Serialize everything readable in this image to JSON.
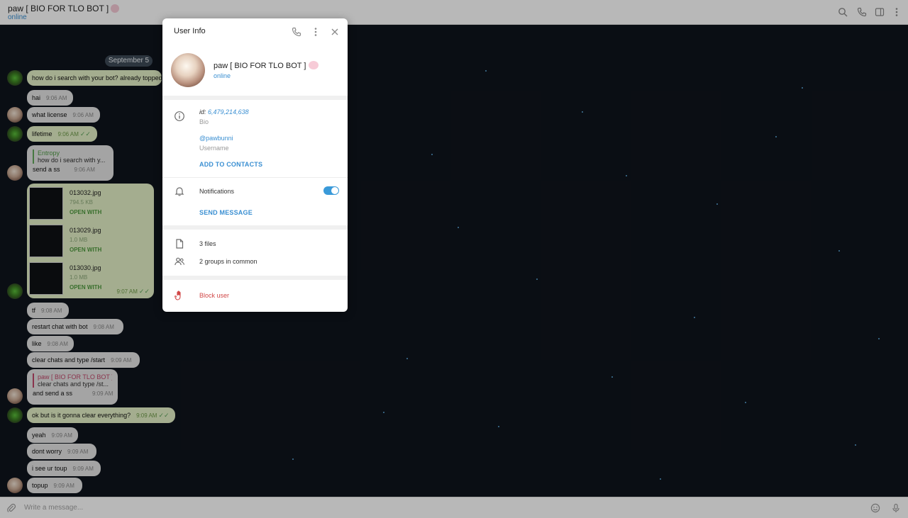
{
  "header": {
    "chat_title": "paw [ BIO FOR TLO BOT ]",
    "chat_status": "online",
    "icons": [
      "search-icon",
      "phone-icon",
      "sidebar-icon",
      "more-icon"
    ]
  },
  "chat": {
    "date_separator": "September 5",
    "messages": [
      {
        "text": "how do i search with your bot? already topped",
        "time": ""
      },
      {
        "text": "hai",
        "time": "9:06 AM"
      },
      {
        "text": "what license",
        "time": "9:06 AM"
      },
      {
        "text": "lifetime",
        "time": "9:06 AM"
      },
      {
        "reply_author": "Entropy",
        "reply_text": "how do i search with y...",
        "text": "send a ss",
        "time": "9:06 AM"
      },
      {
        "text": "tf",
        "time": "9:08 AM"
      },
      {
        "text": "restart chat with bot",
        "time": "9:08 AM"
      },
      {
        "text": "like",
        "time": "9:08 AM"
      },
      {
        "text": "clear chats and type /start",
        "time": "9:09 AM"
      },
      {
        "reply_author": "paw [ BIO FOR TLO BOT ]",
        "reply_text": "clear chats and type /st...",
        "text": "and send a ss",
        "time": "9:09 AM"
      },
      {
        "text": "ok but is it gonna clear everything?",
        "time": "9:09 AM"
      },
      {
        "text": "yeah",
        "time": "9:09 AM"
      },
      {
        "text": "dont worry",
        "time": "9:09 AM"
      },
      {
        "text": "i see ur toup",
        "time": "9:09 AM"
      },
      {
        "text": "topup",
        "time": "9:09 AM"
      }
    ],
    "files": [
      {
        "name": "013032.jpg",
        "size": "794.5 KB",
        "action": "OPEN WITH"
      },
      {
        "name": "013029.jpg",
        "size": "1.0 MB",
        "action": "OPEN WITH"
      },
      {
        "name": "013030.jpg",
        "size": "1.0 MB",
        "action": "OPEN WITH"
      }
    ],
    "files_time": "9:07 AM"
  },
  "composer": {
    "placeholder": "Write a message..."
  },
  "modal": {
    "title": "User Info",
    "name": "paw [ BIO FOR TLO BOT ]",
    "status": "online",
    "id_label": "id:",
    "id_value": "6,479,214,638",
    "bio_label": "Bio",
    "username": "@pawbunni",
    "username_label": "Username",
    "add_contacts": "ADD TO CONTACTS",
    "notifications": "Notifications",
    "notifications_on": true,
    "send_message": "SEND MESSAGE",
    "files": "3 files",
    "groups": "2 groups in common",
    "block": "Block user"
  },
  "colors": {
    "accent": "#3a8fd2",
    "toggle": "#3a9ad9",
    "danger": "#d14848",
    "outgoing_bubble": "#e4f0c6",
    "incoming_bubble": "#e3e3e3"
  }
}
